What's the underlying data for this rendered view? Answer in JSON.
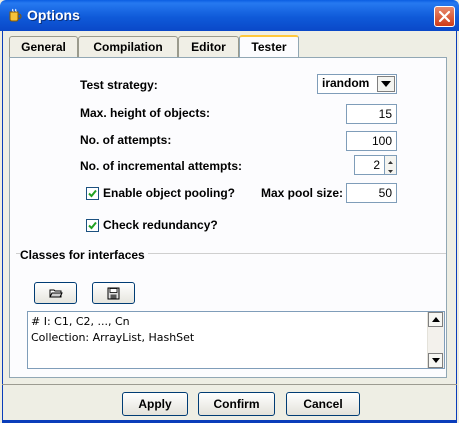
{
  "window": {
    "title": "Options",
    "close_label": "×"
  },
  "tabs": [
    {
      "label": "General"
    },
    {
      "label": "Compilation"
    },
    {
      "label": "Editor"
    },
    {
      "label": "Tester"
    }
  ],
  "active_tab": "Tester",
  "tester": {
    "test_strategy_label": "Test strategy:",
    "test_strategy_value": "irandom",
    "max_height_label": "Max. height of objects:",
    "max_height_value": "15",
    "attempts_label": "No. of attempts:",
    "attempts_value": "100",
    "incremental_label": "No. of incremental attempts:",
    "incremental_value": "2",
    "pooling_label": "Enable object pooling?",
    "pooling_checked": true,
    "pool_size_label": "Max pool size:",
    "pool_size_value": "50",
    "redundancy_label": "Check redundancy?",
    "redundancy_checked": true
  },
  "classes_group": {
    "title": "Classes for interfaces",
    "buttons": [
      {
        "icon": "open-folder-icon"
      },
      {
        "icon": "save-disk-icon"
      }
    ],
    "text_lines": [
      "# I: C1, C2, ..., Cn",
      "Collection: ArrayList, HashSet"
    ]
  },
  "footer": {
    "apply_label": "Apply",
    "confirm_label": "Confirm",
    "cancel_label": "Cancel"
  },
  "colors": {
    "title_bar": "#0a5ae0",
    "active_tab_accent": "#ffc83c",
    "close_button": "#d8482a",
    "panel_bg": "#fcfcfe",
    "window_bg": "#eeeee4"
  }
}
